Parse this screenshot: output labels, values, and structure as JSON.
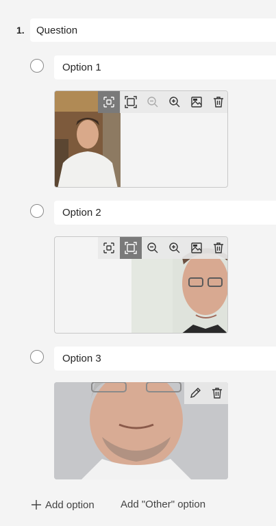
{
  "question": {
    "number": "1.",
    "title": "Question"
  },
  "options": [
    {
      "label": "Option 1"
    },
    {
      "label": "Option 2"
    },
    {
      "label": "Option 3"
    }
  ],
  "footer": {
    "add_option": "Add option",
    "add_other_option": "Add \"Other\" option"
  },
  "colors": {
    "page_bg": "#f4f4f4",
    "field_bg": "#ffffff",
    "active_tool": "#7a7a7a"
  }
}
